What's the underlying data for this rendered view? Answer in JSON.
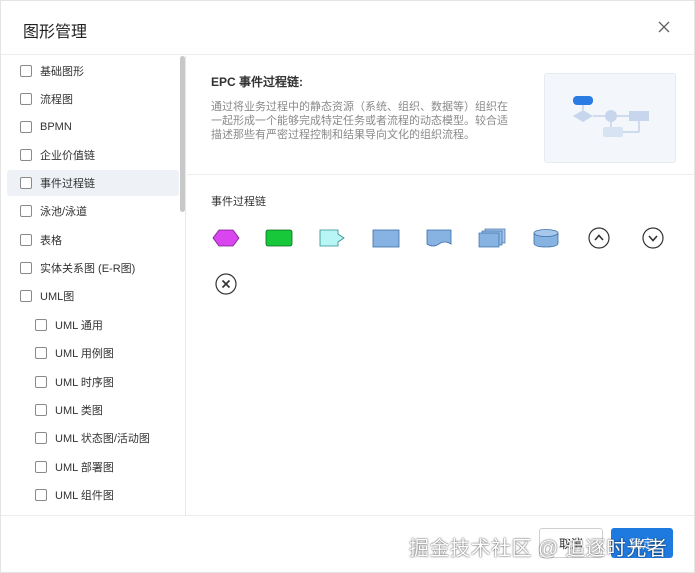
{
  "dialog": {
    "title": "图形管理"
  },
  "sidebar": {
    "items": [
      {
        "label": "基础图形",
        "checked": false
      },
      {
        "label": "流程图",
        "checked": false
      },
      {
        "label": "BPMN",
        "checked": false
      },
      {
        "label": "企业价值链",
        "checked": false
      },
      {
        "label": "事件过程链",
        "checked": false,
        "active": true
      },
      {
        "label": "泳池/泳道",
        "checked": false
      },
      {
        "label": "表格",
        "checked": false
      },
      {
        "label": "实体关系图 (E-R图)",
        "checked": false
      },
      {
        "label": "UML图",
        "checked": false
      },
      {
        "label": "UML 通用",
        "checked": false,
        "indent": true
      },
      {
        "label": "UML 用例图",
        "checked": false,
        "indent": true
      },
      {
        "label": "UML 时序图",
        "checked": false,
        "indent": true
      },
      {
        "label": "UML 类图",
        "checked": false,
        "indent": true
      },
      {
        "label": "UML 状态图/活动图",
        "checked": false,
        "indent": true
      },
      {
        "label": "UML 部署图",
        "checked": false,
        "indent": true
      },
      {
        "label": "UML 组件图",
        "checked": false,
        "indent": true
      }
    ]
  },
  "main": {
    "heading": "EPC 事件过程链:",
    "description": "通过将业务过程中的静态资源（系统、组织、数据等）组织在一起形成一个能够完成特定任务或者流程的动态模型。较合适描述那些有严密过程控制和结果导向文化的组织流程。",
    "section_label": "事件过程链",
    "shapes": [
      {
        "name": "event-hexagon-icon",
        "color": "#d946ef"
      },
      {
        "name": "function-rect-icon",
        "color": "#22c55e"
      },
      {
        "name": "information-flag-icon",
        "color": "#a5f3f3"
      },
      {
        "name": "organization-rect-icon",
        "color": "#7fb0e0"
      },
      {
        "name": "document-icon",
        "color": "#7fb0e0"
      },
      {
        "name": "multi-document-icon",
        "color": "#7fb0e0"
      },
      {
        "name": "database-cylinder-icon",
        "color": "#7fb0e0"
      },
      {
        "name": "and-connector-icon",
        "color": "#333333"
      },
      {
        "name": "or-connector-icon",
        "color": "#333333"
      },
      {
        "name": "xor-connector-icon",
        "color": "#333333"
      }
    ]
  },
  "footer": {
    "cancel_label": "取消",
    "ok_label": "确定",
    "watermark": "掘金技术社区 @ 追逐时光者"
  },
  "colors": {
    "primary": "#1f7ae0",
    "active_bg": "#eef1f6"
  }
}
